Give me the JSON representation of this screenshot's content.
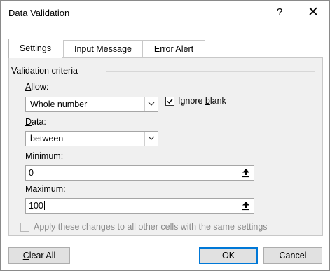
{
  "window": {
    "title": "Data Validation",
    "help_label": "?",
    "close_label": "✕"
  },
  "tabs": [
    {
      "label": "Settings",
      "active": true
    },
    {
      "label": "Input Message",
      "active": false
    },
    {
      "label": "Error Alert",
      "active": false
    }
  ],
  "settings": {
    "section_title": "Validation criteria",
    "allow": {
      "label_accel": "A",
      "label_rest": "llow:",
      "value": "Whole number"
    },
    "ignore_blank": {
      "checked": true,
      "label_pre": "Ignore ",
      "label_accel": "b",
      "label_post": "lank"
    },
    "data": {
      "label_accel": "D",
      "label_rest": "ata:",
      "value": "between"
    },
    "minimum": {
      "label_accel": "M",
      "label_rest": "inimum:",
      "value": "0"
    },
    "maximum": {
      "label_pre": "Ma",
      "label_accel": "x",
      "label_post": "imum:",
      "value": "100"
    },
    "apply_all": {
      "checked": false,
      "enabled": false,
      "label": "Apply these changes to all other cells with the same settings"
    }
  },
  "buttons": {
    "clear_all": {
      "accel": "C",
      "rest": "lear All"
    },
    "ok": "OK",
    "cancel": "Cancel"
  },
  "icon_names": [
    "chevron-down-icon",
    "checkmark-icon",
    "range-picker-icon",
    "close-icon",
    "help-icon"
  ]
}
